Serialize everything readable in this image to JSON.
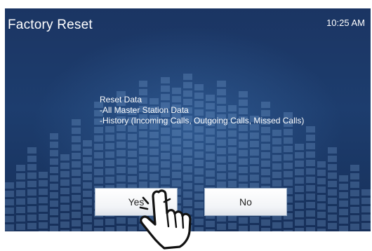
{
  "header": {
    "title": "Factory Reset",
    "time": "10:25 AM"
  },
  "message": {
    "line1": "Reset Data",
    "line2": "-All Master Station Data",
    "line3": "-History (Incoming Calls, Outgoing Calls, Missed Calls)"
  },
  "buttons": {
    "yes_label": "Yes",
    "no_label": "No"
  },
  "icons": {
    "pointer": "hand-pointer-icon"
  },
  "colors": {
    "screen_background": "#1d3d6e",
    "text": "#ffffff",
    "button_background": "#f2f4f7"
  }
}
